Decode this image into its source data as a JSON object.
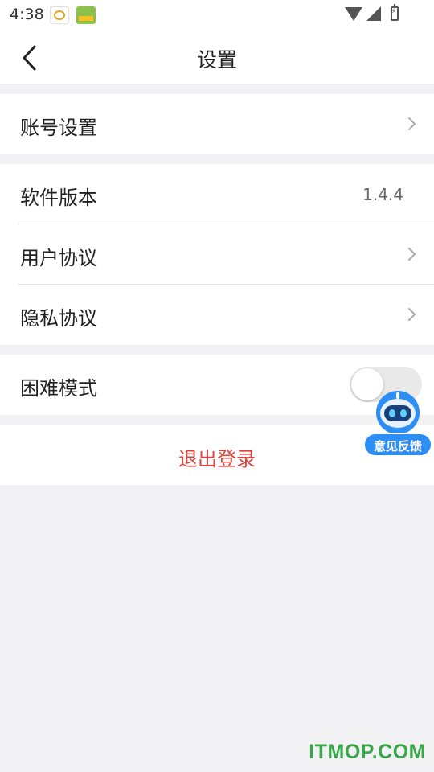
{
  "status_bar": {
    "time": "4:38"
  },
  "header": {
    "title": "设置"
  },
  "groups": [
    {
      "items": [
        {
          "label": "账号设置"
        }
      ]
    },
    {
      "items": [
        {
          "label": "软件版本",
          "value": "1.4.4"
        },
        {
          "label": "用户协议"
        },
        {
          "label": "隐私协议"
        }
      ]
    },
    {
      "items": [
        {
          "label": "困难模式",
          "toggle": false
        }
      ]
    }
  ],
  "logout": {
    "label": "退出登录"
  },
  "feedback": {
    "label": "意见反馈"
  },
  "watermark": {
    "text": "ITMOP.COM"
  },
  "colors": {
    "logout": "#e0423c",
    "feedback": "#2d8ef5",
    "watermark": "#3aa64a",
    "background": "#f2f2f4"
  }
}
